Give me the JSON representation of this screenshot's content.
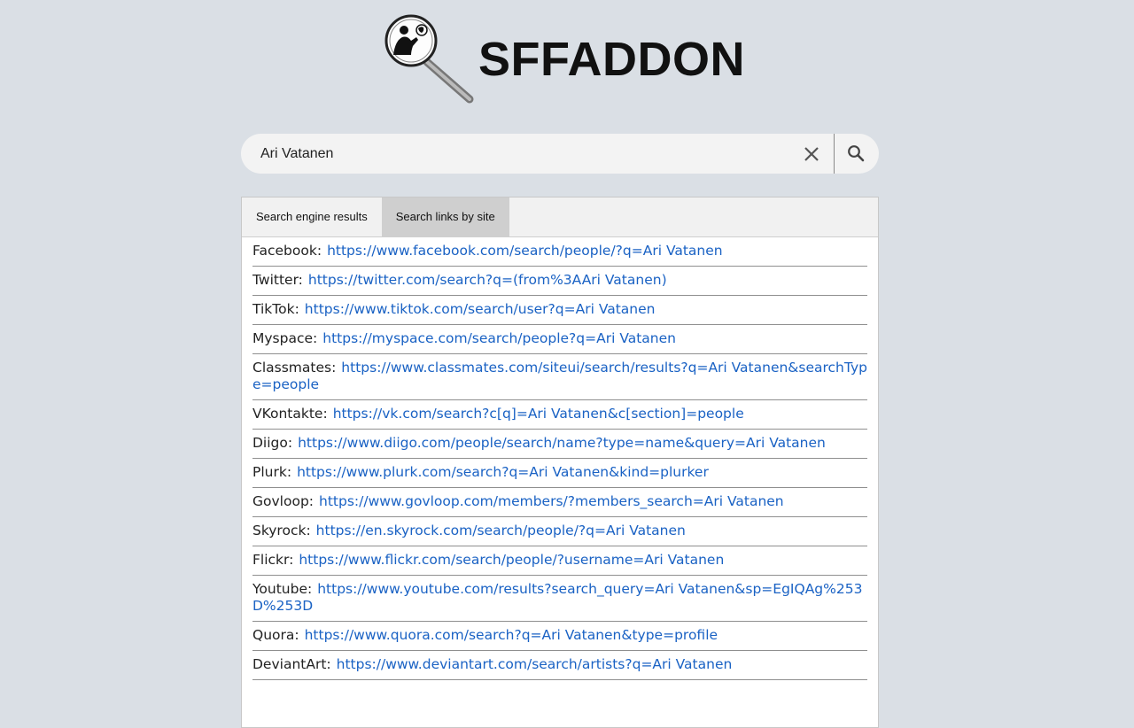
{
  "logo": {
    "text": "SFFADDON"
  },
  "search": {
    "value": "Ari Vatanen"
  },
  "tabs": [
    {
      "label": "Search engine results",
      "active": false
    },
    {
      "label": "Search links by site",
      "active": true
    }
  ],
  "links": [
    {
      "site": "Facebook:",
      "url": "https://www.facebook.com/search/people/?q=Ari Vatanen"
    },
    {
      "site": "Twitter:",
      "url": "https://twitter.com/search?q=(from%3AAri Vatanen)"
    },
    {
      "site": "TikTok:",
      "url": "https://www.tiktok.com/search/user?q=Ari Vatanen"
    },
    {
      "site": "Myspace:",
      "url": "https://myspace.com/search/people?q=Ari Vatanen"
    },
    {
      "site": "Classmates:",
      "url": "https://www.classmates.com/siteui/search/results?q=Ari Vatanen&searchType=people"
    },
    {
      "site": "VKontakte:",
      "url": "https://vk.com/search?c[q]=Ari Vatanen&c[section]=people"
    },
    {
      "site": "Diigo:",
      "url": "https://www.diigo.com/people/search/name?type=name&query=Ari Vatanen"
    },
    {
      "site": "Plurk:",
      "url": "https://www.plurk.com/search?q=Ari Vatanen&kind=plurker"
    },
    {
      "site": "Govloop:",
      "url": "https://www.govloop.com/members/?members_search=Ari Vatanen"
    },
    {
      "site": "Skyrock:",
      "url": "https://en.skyrock.com/search/people/?q=Ari Vatanen"
    },
    {
      "site": "Flickr:",
      "url": "https://www.flickr.com/search/people/?username=Ari Vatanen"
    },
    {
      "site": "Youtube:",
      "url": "https://www.youtube.com/results?search_query=Ari Vatanen&sp=EgIQAg%253D%253D"
    },
    {
      "site": "Quora:",
      "url": "https://www.quora.com/search?q=Ari Vatanen&type=profile"
    },
    {
      "site": "DeviantArt:",
      "url": "https://www.deviantart.com/search/artists?q=Ari Vatanen"
    }
  ]
}
